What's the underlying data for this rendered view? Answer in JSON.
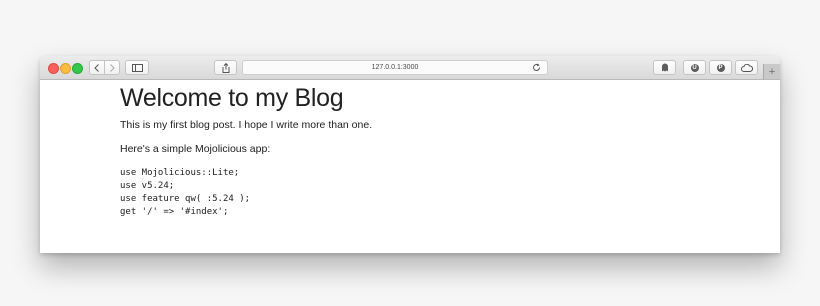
{
  "browser": {
    "address": "127.0.0.1:3000",
    "new_tab_symbol": "+"
  },
  "extensions": [
    {
      "icon": "ghost-icon"
    },
    {
      "icon": "ublock-icon",
      "glyph": "U"
    },
    {
      "icon": "pinterest-icon",
      "glyph": "P"
    },
    {
      "icon": "cloud-icon"
    }
  ],
  "page": {
    "title": "Welcome to my Blog",
    "paragraph1": "This is my first blog post. I hope I write more than one.",
    "paragraph2": "Here's a simple Mojolicious app:",
    "code_lines": [
      "use Mojolicious::Lite;",
      "use v5.24;",
      "use feature qw( :5.24 );",
      "get '/' => '#index';"
    ]
  },
  "colors": {
    "close": "#fc605c",
    "minimize": "#fdbc40",
    "zoom": "#34c84a"
  }
}
